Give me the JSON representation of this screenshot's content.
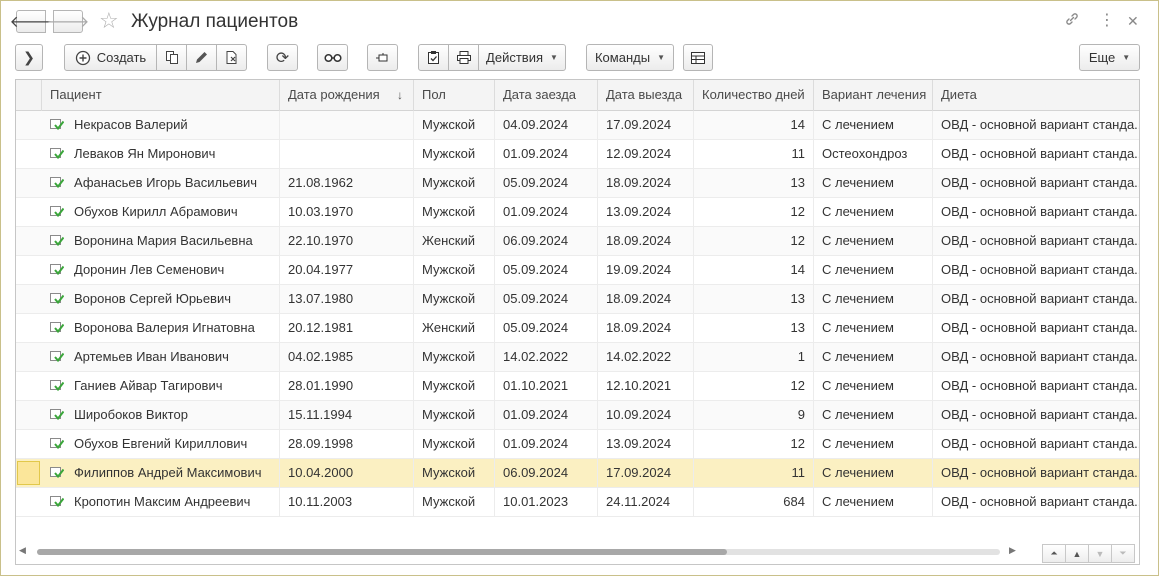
{
  "window": {
    "title": "Журнал пациентов"
  },
  "toolbar": {
    "create_label": "Создать",
    "actions_label": "Действия",
    "commands_label": "Команды",
    "more_label": "Еще"
  },
  "table": {
    "columns": [
      "Пациент",
      "Дата рождения",
      "Пол",
      "Дата заезда",
      "Дата выезда",
      "Количество дней",
      "Вариант лечения",
      "Диета"
    ],
    "sort_indicator": "↓",
    "rows": [
      [
        "Некрасов Валерий",
        "",
        "Мужской",
        "04.09.2024",
        "17.09.2024",
        "14",
        "С лечением",
        "ОВД - основной вариант станда..."
      ],
      [
        "Леваков Ян Миронович",
        "",
        "Мужской",
        "01.09.2024",
        "12.09.2024",
        "11",
        "Остеохондроз",
        "ОВД - основной вариант станда..."
      ],
      [
        "Афанасьев Игорь Васильевич",
        "21.08.1962",
        "Мужской",
        "05.09.2024",
        "18.09.2024",
        "13",
        "С лечением",
        "ОВД - основной вариант станда..."
      ],
      [
        "Обухов Кирилл Абрамович",
        "10.03.1970",
        "Мужской",
        "01.09.2024",
        "13.09.2024",
        "12",
        "С лечением",
        "ОВД - основной вариант станда..."
      ],
      [
        "Воронина Мария Васильевна",
        "22.10.1970",
        "Женский",
        "06.09.2024",
        "18.09.2024",
        "12",
        "С лечением",
        "ОВД - основной вариант станда..."
      ],
      [
        "Доронин Лев Семенович",
        "20.04.1977",
        "Мужской",
        "05.09.2024",
        "19.09.2024",
        "14",
        "С лечением",
        "ОВД - основной вариант станда..."
      ],
      [
        "Воронов Сергей Юрьевич",
        "13.07.1980",
        "Мужской",
        "05.09.2024",
        "18.09.2024",
        "13",
        "С лечением",
        "ОВД - основной вариант станда..."
      ],
      [
        "Воронова Валерия Игнатовна",
        "20.12.1981",
        "Женский",
        "05.09.2024",
        "18.09.2024",
        "13",
        "С лечением",
        "ОВД - основной вариант станда..."
      ],
      [
        "Артемьев Иван Иванович",
        "04.02.1985",
        "Мужской",
        "14.02.2022",
        "14.02.2022",
        "1",
        "С лечением",
        "ОВД - основной вариант станда..."
      ],
      [
        "Ганиев Айвар Тагирович",
        "28.01.1990",
        "Мужской",
        "01.10.2021",
        "12.10.2021",
        "12",
        "С лечением",
        "ОВД - основной вариант станда..."
      ],
      [
        "Широбоков Виктор",
        "15.11.1994",
        "Мужской",
        "01.09.2024",
        "10.09.2024",
        "9",
        "С лечением",
        "ОВД - основной вариант станда..."
      ],
      [
        "Обухов Евгений Кириллович",
        "28.09.1998",
        "Мужской",
        "01.09.2024",
        "13.09.2024",
        "12",
        "С лечением",
        "ОВД - основной вариант станда..."
      ],
      [
        "Филиппов Андрей Максимович",
        "10.04.2000",
        "Мужской",
        "06.09.2024",
        "17.09.2024",
        "11",
        "С лечением",
        "ОВД - основной вариант станда..."
      ],
      [
        "Кропотин Максим Андреевич",
        "10.11.2003",
        "Мужской",
        "10.01.2023",
        "24.11.2024",
        "684",
        "С лечением",
        "ОВД - основной вариант станда..."
      ]
    ],
    "selected_row": 12
  },
  "colors": {
    "selected_row": "#fbf0c2",
    "border_accent": "#c9c08a",
    "row_icon": "#3aa63a"
  }
}
